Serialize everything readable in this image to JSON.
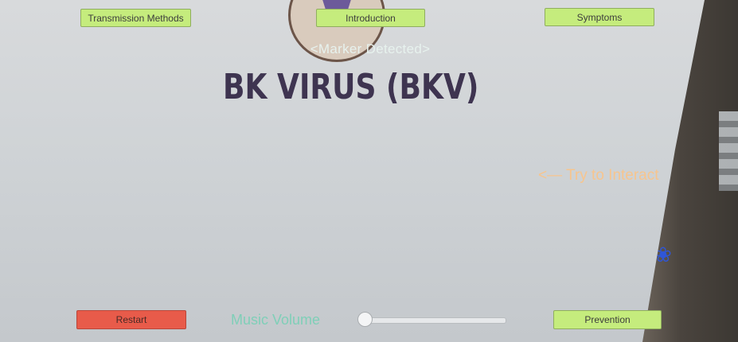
{
  "nav": {
    "transmission_label": "Transmission Methods",
    "introduction_label": "Introduction",
    "symptoms_label": "Symptoms"
  },
  "status": {
    "marker_text": "<Marker Detected>"
  },
  "main": {
    "title": "BK VIRUS (BKV)",
    "hint": "<— Try to Interact"
  },
  "footer": {
    "restart_label": "Restart",
    "music_volume_label": "Music Volume",
    "music_volume_value": 0,
    "prevention_label": "Prevention"
  },
  "colors": {
    "button_green": "#c5ec7d",
    "button_red": "#e85b4a",
    "title_color": "#3e3450",
    "hint_color": "#f7c58e",
    "marker_color": "#e7f2ee",
    "volume_label_color": "#7fcfb8"
  }
}
